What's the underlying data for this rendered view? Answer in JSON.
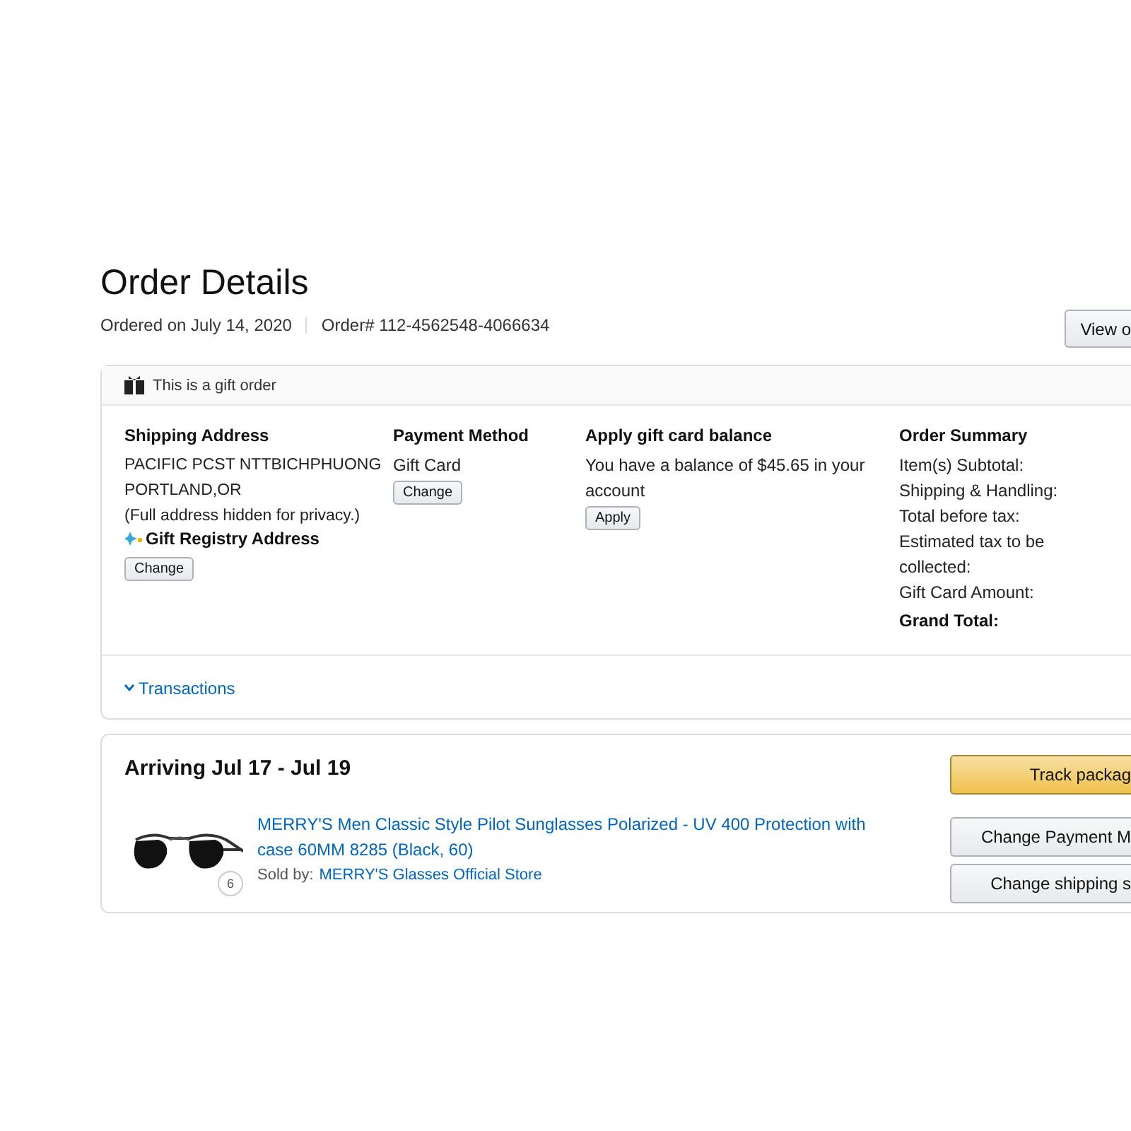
{
  "page": {
    "title": "Order Details",
    "ordered_on": "Ordered on July 14, 2020",
    "order_number": "Order# 112-4562548-4066634",
    "view_button": "View o"
  },
  "gift_card_panel": {
    "gift_notice": "This is a gift order",
    "shipping": {
      "heading": "Shipping Address",
      "lines": [
        "PACIFIC PCST NTTBICHPHUONG",
        "PORTLAND,OR",
        "(Full address hidden for privacy.)"
      ],
      "registry": "Gift Registry Address",
      "button": "Change"
    },
    "payment": {
      "heading": "Payment Method",
      "method": "Gift Card",
      "button": "Change"
    },
    "gift_balance": {
      "heading": "Apply gift card balance",
      "text": "You have a balance of $45.65 in your account",
      "button": "Apply"
    },
    "summary": {
      "heading": "Order Summary",
      "lines": [
        "Item(s) Subtotal:",
        "Shipping & Handling:",
        "Total before tax:",
        "Estimated tax to be collected:",
        "Gift Card Amount:"
      ],
      "grand_total": "Grand Total:"
    },
    "transactions": {
      "label": "Transactions",
      "expanded": false
    }
  },
  "shipment": {
    "title": "Arriving Jul 17 - Jul 19",
    "item": {
      "kind": "picture",
      "quantity": "6",
      "name": "MERRY'S Men Classic Style Pilot Sunglasses Polarized - UV 400 Protection with case 60MM 8285 (Black, 60)",
      "sold_by_label": "Sold by:",
      "seller": "MERRY'S Glasses Official Store"
    },
    "actions": [
      {
        "label": "Track packag",
        "kind": "primary"
      },
      {
        "label": "Change Payment M",
        "kind": "secondary"
      },
      {
        "label": "Change shipping s",
        "kind": "secondary"
      }
    ]
  }
}
